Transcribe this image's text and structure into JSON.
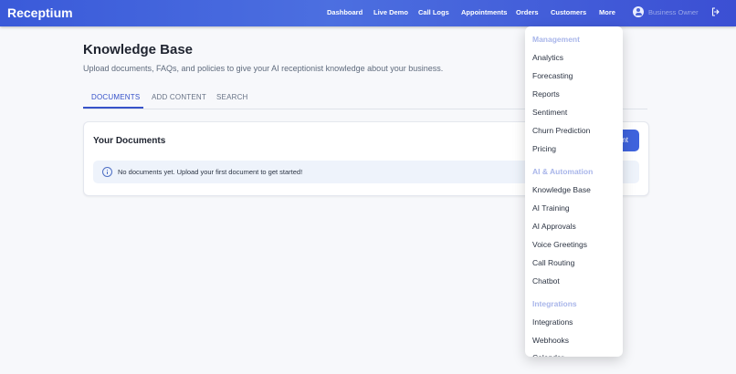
{
  "brand": "Receptium",
  "nav": [
    {
      "label": "Dashboard"
    },
    {
      "label": "Live Demo"
    },
    {
      "label": "Call Logs"
    },
    {
      "label": "Appointments"
    },
    {
      "label": "Orders"
    },
    {
      "label": "Customers"
    },
    {
      "label": "More"
    }
  ],
  "user": {
    "name": "Business Owner",
    "avatar_icon": "user-circle-icon",
    "logout_icon": "logout-icon"
  },
  "page": {
    "title": "Knowledge Base",
    "subtitle": "Upload documents, FAQs, and policies to give your AI receptionist knowledge about your business."
  },
  "tabs": [
    {
      "label": "DOCUMENTS",
      "active": true
    },
    {
      "label": "ADD CONTENT",
      "active": false
    },
    {
      "label": "SEARCH",
      "active": false
    }
  ],
  "documents_card": {
    "title": "Your Documents",
    "button_visible_text": "nt",
    "empty_message": "No documents yet. Upload your first document to get started!",
    "info_icon": "info-icon"
  },
  "more_menu": {
    "groups": [
      {
        "heading": "Management",
        "items": [
          "Analytics",
          "Forecasting",
          "Reports",
          "Sentiment",
          "Churn Prediction",
          "Pricing"
        ]
      },
      {
        "heading": "AI & Automation",
        "items": [
          "Knowledge Base",
          "AI Training",
          "AI Approvals",
          "Voice Greetings",
          "Call Routing",
          "Chatbot"
        ]
      },
      {
        "heading": "Integrations",
        "items": [
          "Integrations",
          "Webhooks"
        ]
      }
    ],
    "partial_item": "Calendar"
  },
  "colors": {
    "header_gradient_start": "#3a5ad9",
    "header_gradient_end": "#3b4fd3",
    "accent": "#3652c9",
    "button": "#3f63dd",
    "info_background": "#eef3fb"
  }
}
